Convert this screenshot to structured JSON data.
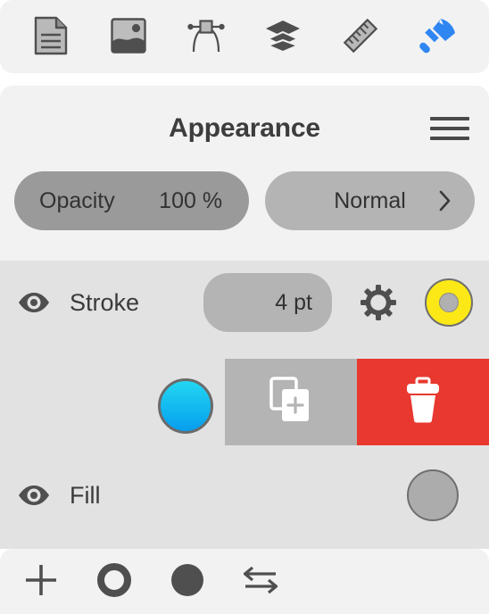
{
  "top_toolbar": {
    "items": [
      {
        "name": "document-icon",
        "label": "Document",
        "active": false
      },
      {
        "name": "image-icon",
        "label": "Image",
        "active": false
      },
      {
        "name": "node-icon",
        "label": "Node",
        "active": false
      },
      {
        "name": "layers-icon",
        "label": "Layers",
        "active": false
      },
      {
        "name": "ruler-icon",
        "label": "Ruler",
        "active": false
      },
      {
        "name": "paintbrush-icon",
        "label": "Appearance",
        "active": true
      }
    ]
  },
  "appearance": {
    "title": "Appearance",
    "menu_label": "Menu",
    "opacity": {
      "label": "Opacity",
      "value": "100 %"
    },
    "blend_mode": {
      "value": "Normal",
      "chevron": "chevron-right-icon"
    }
  },
  "stroke": {
    "label": "Stroke",
    "visible": true,
    "width": "4 pt",
    "settings_label": "Stroke settings",
    "color": "#fbe816"
  },
  "actions": {
    "color_swatch": "#12b8ef",
    "duplicate_label": "Duplicate",
    "delete_label": "Delete"
  },
  "fill": {
    "label": "Fill",
    "visible": true,
    "color": "#acacac"
  },
  "bottom_toolbar": {
    "items": [
      {
        "name": "add-icon",
        "label": "Add"
      },
      {
        "name": "stroke-ring-icon",
        "label": "Stroke"
      },
      {
        "name": "fill-circle-icon",
        "label": "Fill"
      },
      {
        "name": "swap-icon",
        "label": "Swap"
      }
    ]
  },
  "colors": {
    "panel_bg": "#f2f2f2",
    "body_bg": "#e2e2e2",
    "accent_blue": "#2f86f2",
    "delete_red": "#e8382f",
    "icon_gray": "#4f4f4f"
  }
}
